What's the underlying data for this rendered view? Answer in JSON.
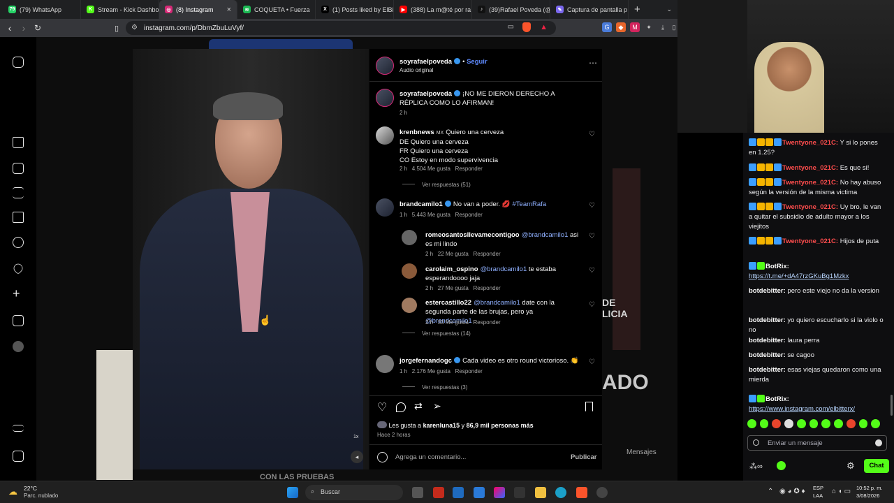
{
  "browser": {
    "tabs": [
      {
        "label": "(79) WhatsApp",
        "color": "#25d366",
        "icon": "whatsapp-icon",
        "glyph": "79"
      },
      {
        "label": "Stream - Kick Dashbo",
        "color": "#53fc18",
        "icon": "kick-icon",
        "glyph": "K"
      },
      {
        "label": "(8) Instagram",
        "color": "#d62976",
        "icon": "instagram-icon",
        "glyph": "◎"
      },
      {
        "label": "COQUETA • Fuerza",
        "color": "#1db954",
        "icon": "spotify-icon",
        "glyph": "≋"
      },
      {
        "label": "(1) Posts liked by ElBit",
        "color": "#000000",
        "icon": "x-icon",
        "glyph": "X"
      },
      {
        "label": "(388) La m@té por ra",
        "color": "#ff0000",
        "icon": "youtube-icon",
        "glyph": "▶"
      },
      {
        "label": "(39)Rafael Poveda (@",
        "color": "#111111",
        "icon": "tiktok-icon",
        "glyph": "♪"
      },
      {
        "label": "Captura de pantalla p",
        "color": "#7b68ee",
        "icon": "pen-icon",
        "glyph": "✎"
      }
    ],
    "url": "instagram.com/p/DbmZbuLuVyf/"
  },
  "post": {
    "author": "soyrafaelpoveda",
    "follow_label": "Seguir",
    "audio": "Audio original",
    "caption": "¡NO ME DIERON DERECHO A RÉPLICA COMO LO AFIRMAN!",
    "caption_time": "2 h",
    "likes_prefix": "Les gusta a",
    "likes_user": "karenluna15",
    "likes_mid": " y ",
    "likes_count": "86,9 mil personas más",
    "time_ago": "Hace 2 horas",
    "comment_placeholder": "Agrega un comentario...",
    "publish_label": "Publicar",
    "speed_label": "1x"
  },
  "comments": [
    {
      "user": "krenbnews",
      "prefix": "MX",
      "lines": [
        "Quiero una cerveza",
        "DE Quiero una cerveza",
        "FR Quiero una cerveza",
        "CO Estoy en modo supervivencia"
      ],
      "time": "2 h",
      "likes": "4.504 Me gusta",
      "reply": "Responder",
      "view_replies": "Ver respuestas (51)"
    },
    {
      "user": "brandcamilo1",
      "text": "No van a poder. 💋",
      "tag": "#TeamRafa",
      "time": "1 h",
      "likes": "5.443 Me gusta",
      "reply": "Responder"
    },
    {
      "user": "romeosantosllevamecontigoo",
      "mention": "@brandcamilo1",
      "text": " asi es mi lindo",
      "time": "2 h",
      "likes": "22 Me gusta",
      "reply": "Responder"
    },
    {
      "user": "carolaim_ospino",
      "mention": "@brandcamilo1",
      "text": " te estaba esperandoooo jaja",
      "time": "2 h",
      "likes": "27 Me gusta",
      "reply": "Responder"
    },
    {
      "user": "estercastillo22",
      "mention": "@brandcamilo1",
      "text": " date con la segunda parte de las brujas, pero ya ",
      "mention2": "@brandcamilo1",
      "time": "2 h",
      "likes": "33 Me gusta",
      "reply": "Responder",
      "view_replies": "Ver respuestas (14)"
    },
    {
      "user": "jorgefernandogc",
      "text": "Cada video es otro round victorioso. 👏",
      "time": "1 h",
      "likes": "2.176 Me gusta",
      "reply": "Responder",
      "view_replies": "Ver respuestas (3)"
    }
  ],
  "background": {
    "messages_label": "Mensajes",
    "bottom_text": "CON LAS PRUEBAS",
    "side_text": "ADO",
    "side_text2": "DE LICIA"
  },
  "chat": {
    "messages": [
      {
        "user": "Twentyone_021C:",
        "text": " Y si lo pones en 1.25?"
      },
      {
        "user": "Twentyone_021C:",
        "text": " Es que si!"
      },
      {
        "user": "Twentyone_021C:",
        "text": " No hay abuso según la versión de la misma victima"
      },
      {
        "user": "Twentyone_021C:",
        "text": " Uy bro, le van a quitar el subsidio de adulto mayor a los viejitos"
      },
      {
        "user": "Twentyone_021C:",
        "text": " Hijos de puta"
      },
      {
        "user": "BotRix:",
        "link": "https://t.me/+dA47rzGKuBg1Mzkx"
      },
      {
        "user": "botdebitter:",
        "text": " pero este viejo no da la version"
      },
      {
        "user": "botdebitter:",
        "text": " yo quiero escucharlo si la violo o no"
      },
      {
        "user": "botdebitter:",
        "text": " laura perra"
      },
      {
        "user": "botdebitter:",
        "text": " se cagoo"
      },
      {
        "user": "botdebitter:",
        "text": " esas viejas quedaron como una mierda"
      },
      {
        "user": "BotRix:",
        "link": "https://www.instagram.com/elbitterx/"
      }
    ],
    "input_placeholder": "Enviar un mensaje",
    "send_label": "Chat"
  },
  "taskbar": {
    "temp": "22°C",
    "weather": "Parc. nublado",
    "search": "Buscar",
    "lang1": "ESP",
    "lang2": "LAA",
    "time": "10:52 p. m.",
    "date": "3/08/2026"
  }
}
